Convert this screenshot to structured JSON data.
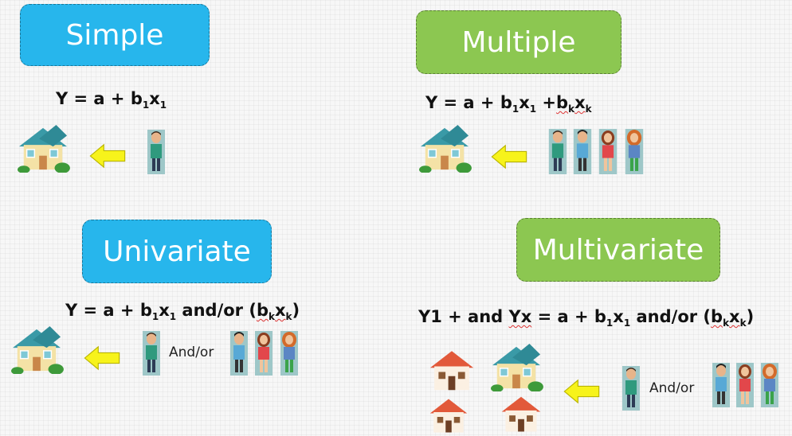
{
  "boxes": {
    "simple": "Simple",
    "multiple": "Multiple",
    "univariate": "Univariate",
    "multivariate": "Multivariate"
  },
  "formulas": {
    "simple": {
      "lead": "Y = a + b",
      "x": "x"
    },
    "multiple": {
      "lead": "Y = a + b",
      "x": "x",
      "plus": " +",
      "b": "b",
      "k": "k",
      "x2": "x",
      "k2": "k"
    },
    "univariate": {
      "lead": "Y = a + b",
      "x": "x",
      "tail": " and/or (",
      "b": "b",
      "k": "k",
      "x2": "x",
      "k2": "k",
      "close": ")"
    },
    "multivariate": {
      "y1": "Y1 + and ",
      "yx": "Yx",
      "mid": " = a + b",
      "x": "x",
      "tail": " and/or (",
      "b": "b",
      "k": "k",
      "x2": "x",
      "k2": "k",
      "close": ")"
    }
  },
  "subscript_one": "1",
  "andor_label": "And/or",
  "colors": {
    "blue": "#27b6ec",
    "green": "#8cc751",
    "arrow": "#f7f31b"
  }
}
